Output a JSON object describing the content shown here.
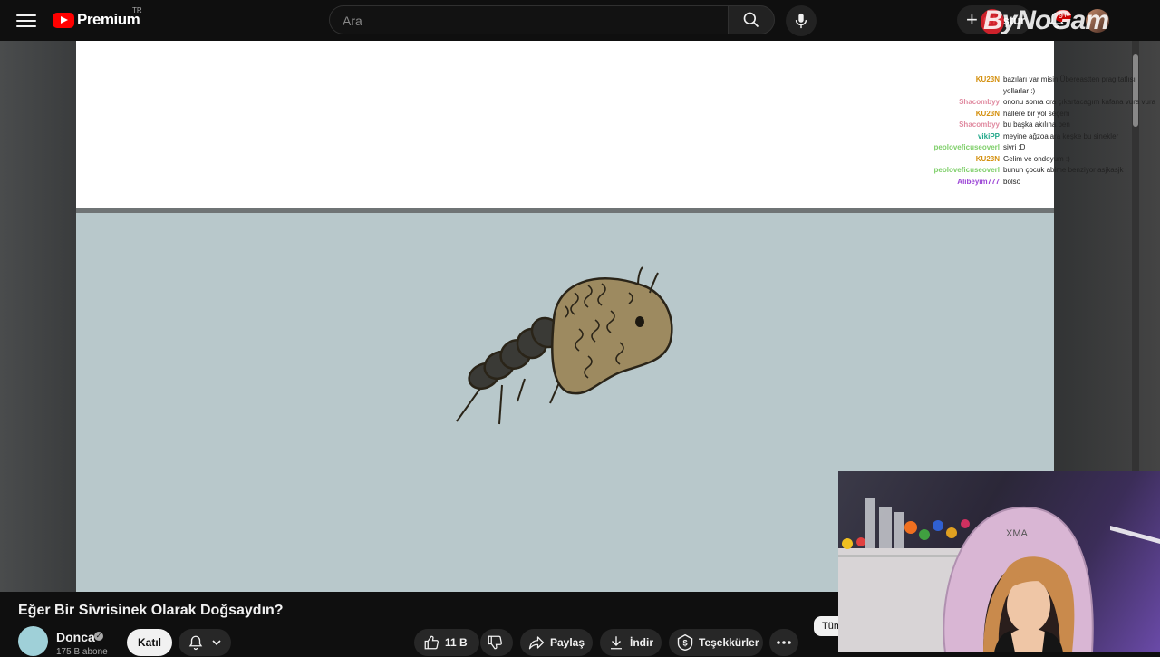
{
  "header": {
    "logo_text": "Premium",
    "logo_region": "TR",
    "search_placeholder": "Ara",
    "create_label": "Oluştur",
    "notification_count": "9+",
    "watermark": "ByNoGam"
  },
  "chat": [
    {
      "user": "KU23N",
      "color": "#d4900e",
      "message": "bazıları var misin Übereastten prag tatlısı"
    },
    {
      "user": "",
      "color": "#d4900e",
      "message": "yollarlar :)"
    },
    {
      "user": "Shacombyy",
      "color": "#e08aa0",
      "message": "ononu sonra ora çıkartacagım kafana vura vura"
    },
    {
      "user": "KU23N",
      "color": "#d4900e",
      "message": "hallere bir yol seçem"
    },
    {
      "user": "Shacombyy",
      "color": "#e08aa0",
      "message": "bu başka akılına ben"
    },
    {
      "user": "vikiPP",
      "color": "#22a88a",
      "message": "meyine ağzoalara keşke bu sinekler"
    },
    {
      "user": "peoloveficuseoverl",
      "color": "#7fcf6a",
      "message": "sivri :D"
    },
    {
      "user": "KU23N",
      "color": "#d4900e",
      "message": "Gelim ve ondoyum :)"
    },
    {
      "user": "peoloveficuseoverl",
      "color": "#7fcf6a",
      "message": "bunun çocuk abime benziyor asjkasjk"
    },
    {
      "user": "Alibeyim777",
      "color": "#9b44d6",
      "message": "bolso"
    }
  ],
  "video": {
    "title": "Eğer Bir Sivrisinek Olarak Doğsaydın?"
  },
  "channel": {
    "name": "Donca",
    "subscribers": "175 B abone",
    "join_label": "Katıl"
  },
  "actions": {
    "likes": "11 B",
    "share_label": "Paylaş",
    "download_label": "İndir",
    "thanks_label": "Teşekkürler"
  },
  "side_chip": "Tümü"
}
